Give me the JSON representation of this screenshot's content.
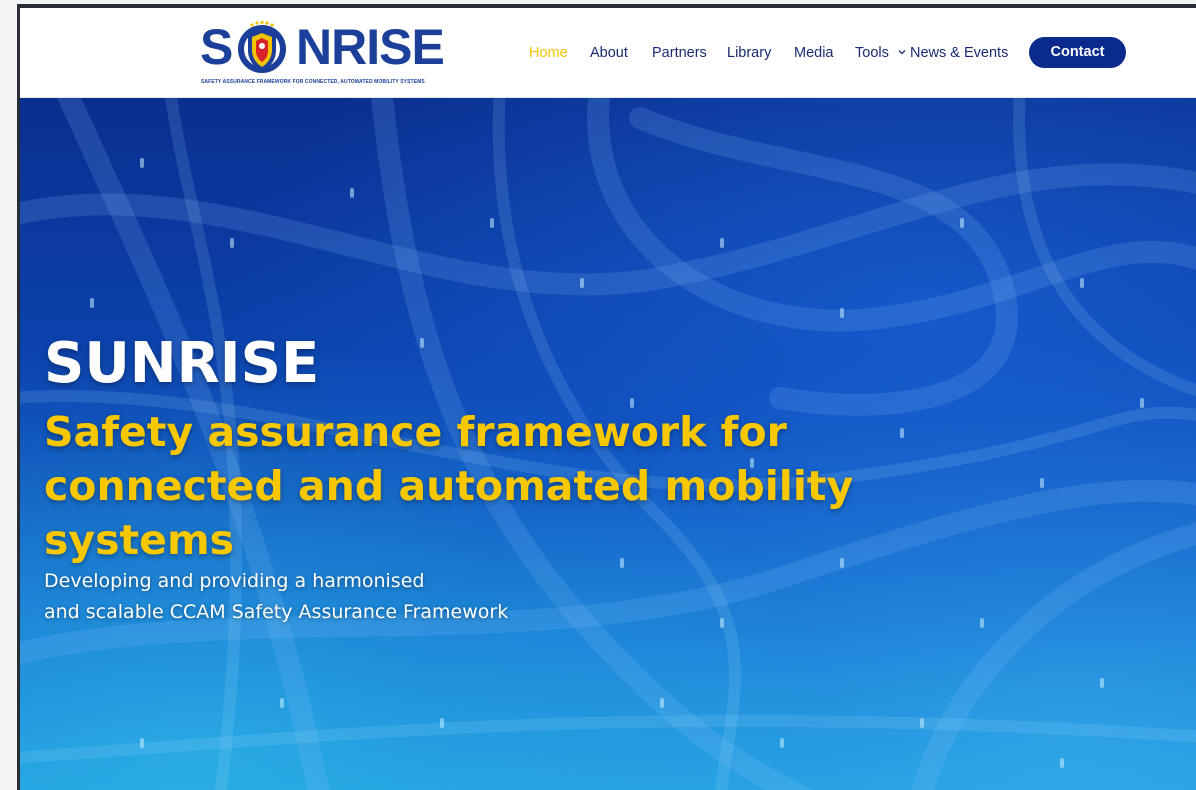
{
  "logo": {
    "letter_s": "S",
    "rest": "NRISE",
    "tagline": "SAFETY ASSURANCE FRAMEWORK FOR CONNECTED, AUTOMATED MOBILITY SYSTEMS",
    "icon": "shield-emblem-icon",
    "brand_color": "#1c3f99"
  },
  "nav": {
    "items": [
      {
        "label": "Home",
        "active": true
      },
      {
        "label": "About"
      },
      {
        "label": "Partners"
      },
      {
        "label": "Library"
      },
      {
        "label": "Media"
      },
      {
        "label": "Tools",
        "has_dropdown": true,
        "dropdown_icon": "chevron-down-icon"
      },
      {
        "label": "News & Events"
      }
    ],
    "contact_label": "Contact",
    "active_color": "#f5c400",
    "link_color": "#1b2a73",
    "contact_color": "#0a2a8c"
  },
  "hero": {
    "title": "SUNRISE",
    "subtitle": "Safety assurance framework for connected and automated mobility systems",
    "description_line1": "Developing and providing a harmonised",
    "description_line2": "and scalable CCAM Safety Assurance Framework",
    "title_color": "#ffffff",
    "subtitle_color": "#f7c700"
  }
}
